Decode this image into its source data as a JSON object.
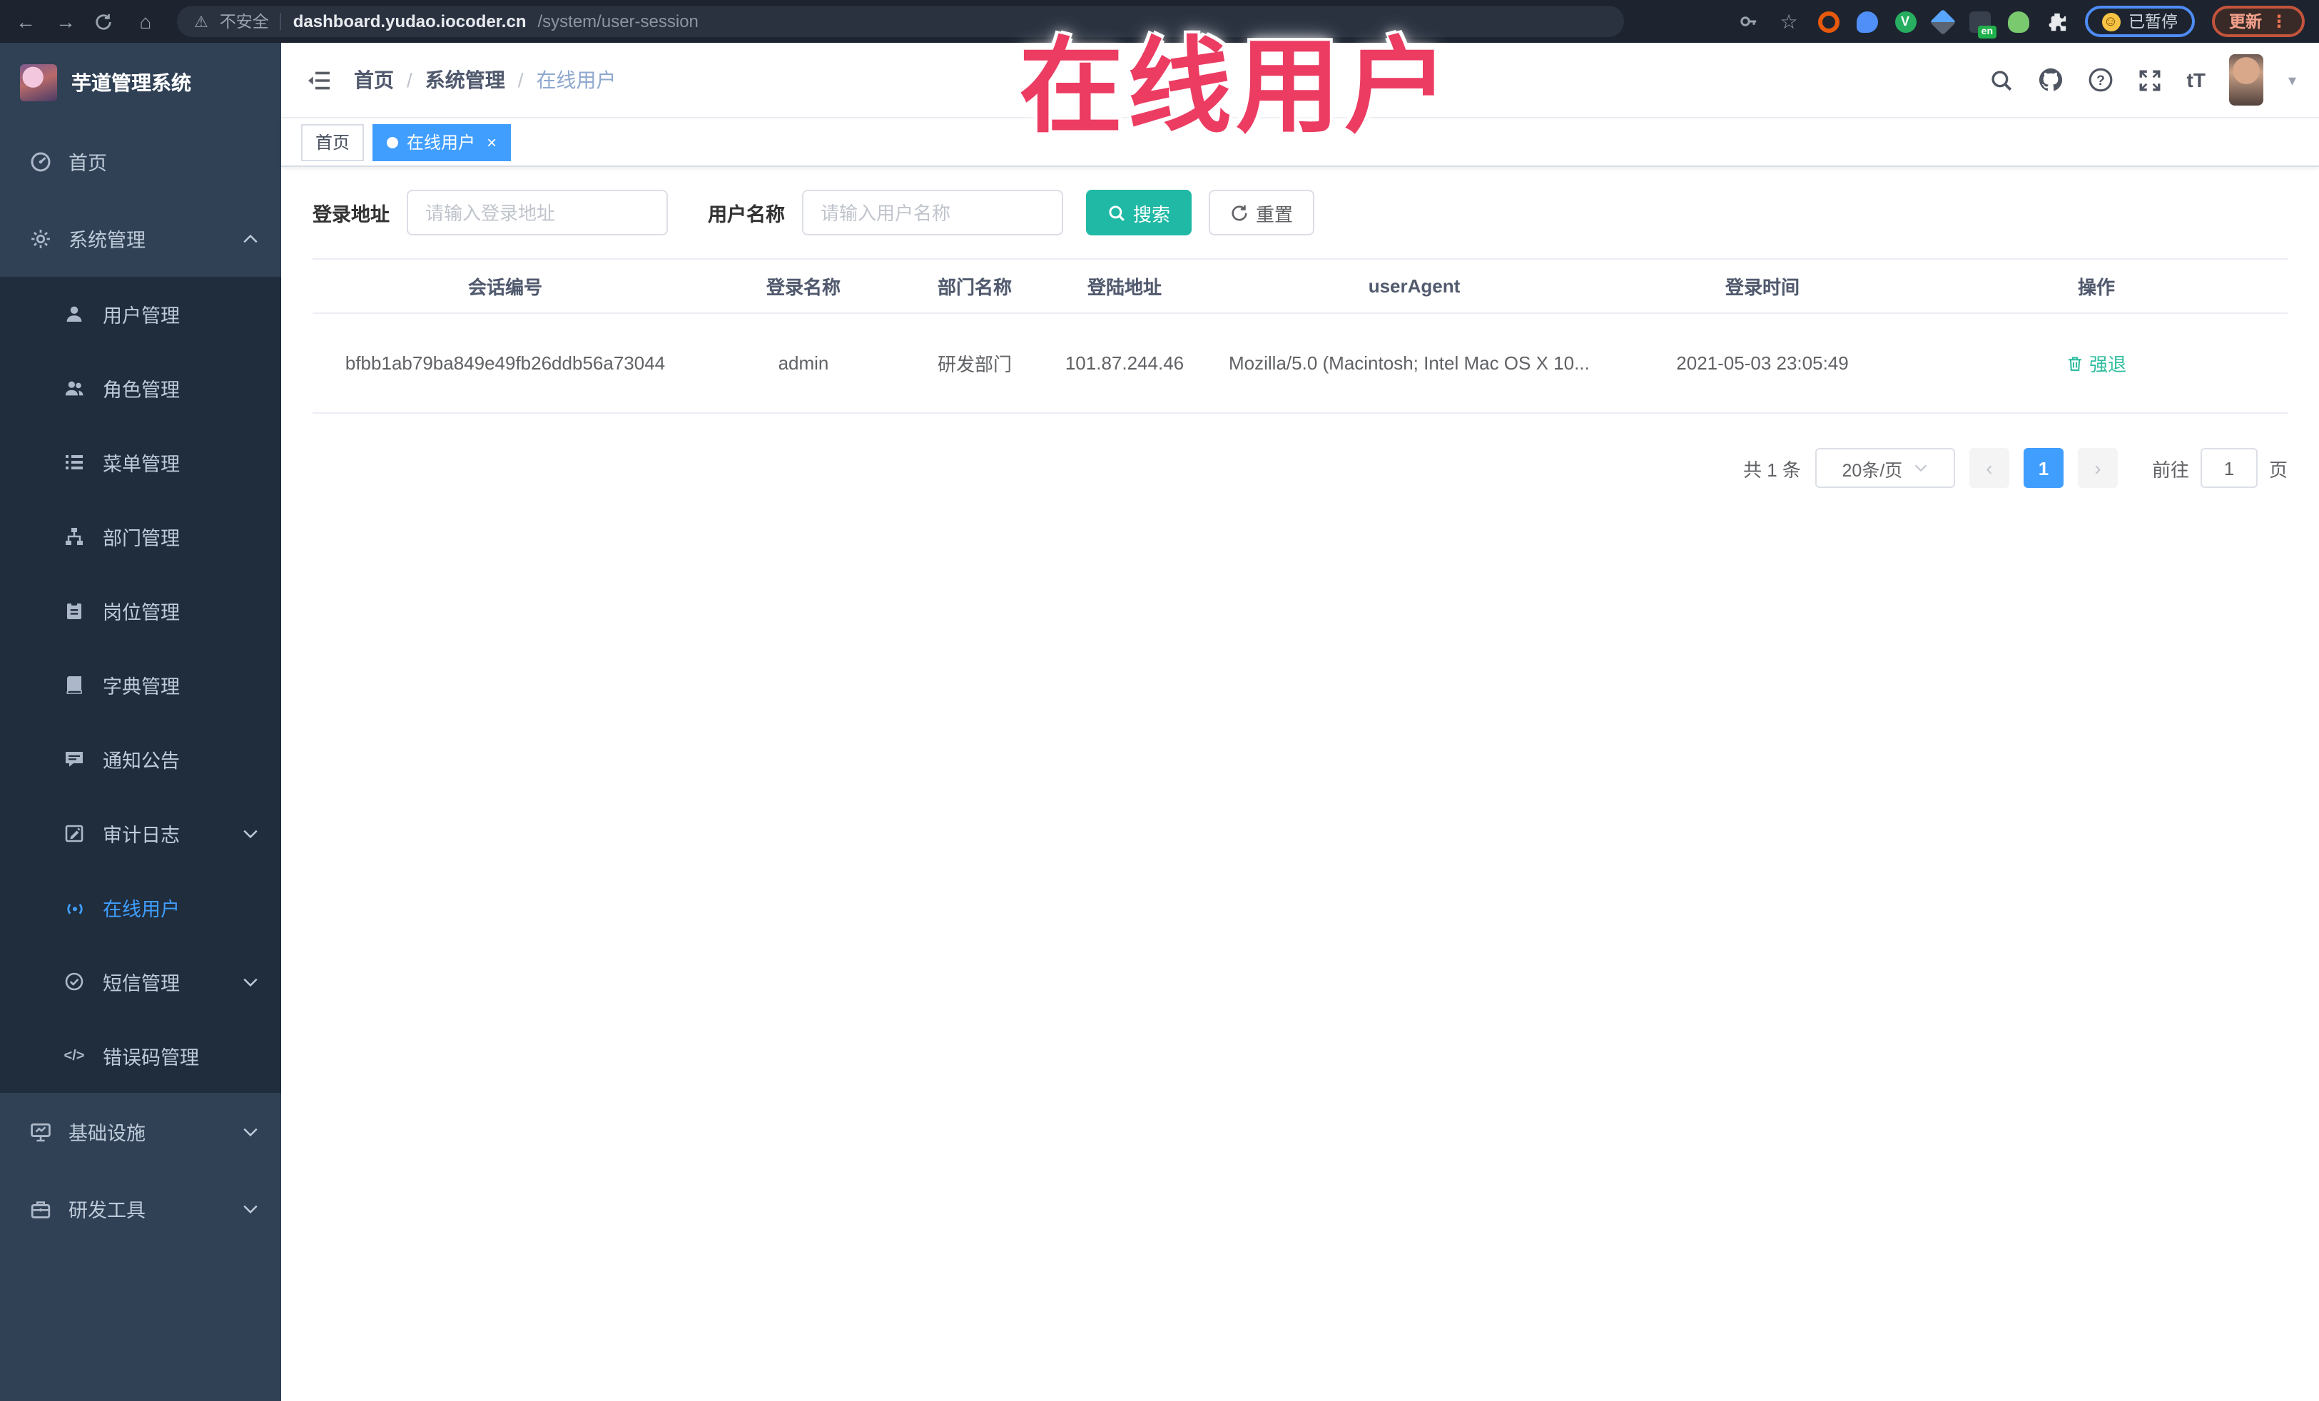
{
  "browser": {
    "security_label": "不安全",
    "url_host": "dashboard.yudao.iocoder.cn",
    "url_path": "/system/user-session",
    "en_badge": "en",
    "paused_label": "已暂停",
    "update_label": "更新"
  },
  "icons": {
    "back": "←",
    "forward": "→",
    "home": "⌂",
    "warning": "⚠",
    "star": "☆",
    "smiley": "☺",
    "kebab": "⋮",
    "close": "×",
    "caret_down": "▾",
    "slash": "/",
    "prev": "‹",
    "next": "›",
    "code": "</>",
    "text_size": "tT"
  },
  "colors": {
    "accent_blue": "#409eff",
    "teal_button": "#20b9a5",
    "annotation_red": "#ec3c62",
    "sidebar_bg": "#304156",
    "submenu_bg": "#1f2d3d"
  },
  "overlay": {
    "text": "在线用户"
  },
  "sidebar": {
    "logo_title": "芋道管理系统",
    "items": [
      {
        "label": "首页"
      },
      {
        "label": "系统管理"
      },
      {
        "label": "用户管理"
      },
      {
        "label": "角色管理"
      },
      {
        "label": "菜单管理"
      },
      {
        "label": "部门管理"
      },
      {
        "label": "岗位管理"
      },
      {
        "label": "字典管理"
      },
      {
        "label": "通知公告"
      },
      {
        "label": "审计日志"
      },
      {
        "label": "在线用户"
      },
      {
        "label": "短信管理"
      },
      {
        "label": "错误码管理"
      },
      {
        "label": "基础设施"
      },
      {
        "label": "研发工具"
      }
    ]
  },
  "header": {
    "breadcrumb": [
      "首页",
      "系统管理",
      "在线用户"
    ]
  },
  "tags": [
    {
      "label": "首页"
    },
    {
      "label": "在线用户"
    }
  ],
  "filters": {
    "login_address_label": "登录地址",
    "login_address_placeholder": "请输入登录地址",
    "username_label": "用户名称",
    "username_placeholder": "请输入用户名称",
    "search_label": "搜索",
    "reset_label": "重置"
  },
  "table": {
    "columns": [
      "会话编号",
      "登录名称",
      "部门名称",
      "登陆地址",
      "userAgent",
      "登录时间",
      "操作"
    ],
    "rows": [
      {
        "session_id": "bfbb1ab79ba849e49fb26ddb56a73044",
        "username": "admin",
        "dept": "研发部门",
        "ip": "101.87.244.46",
        "user_agent": "Mozilla/5.0 (Macintosh; Intel Mac OS X 10...",
        "login_time": "2021-05-03 23:05:49",
        "action": "强退"
      }
    ]
  },
  "pagination": {
    "total_text": "共 1 条",
    "page_size": "20条/页",
    "current_page": "1",
    "goto_label": "前往",
    "goto_value": "1",
    "page_unit": "页"
  }
}
